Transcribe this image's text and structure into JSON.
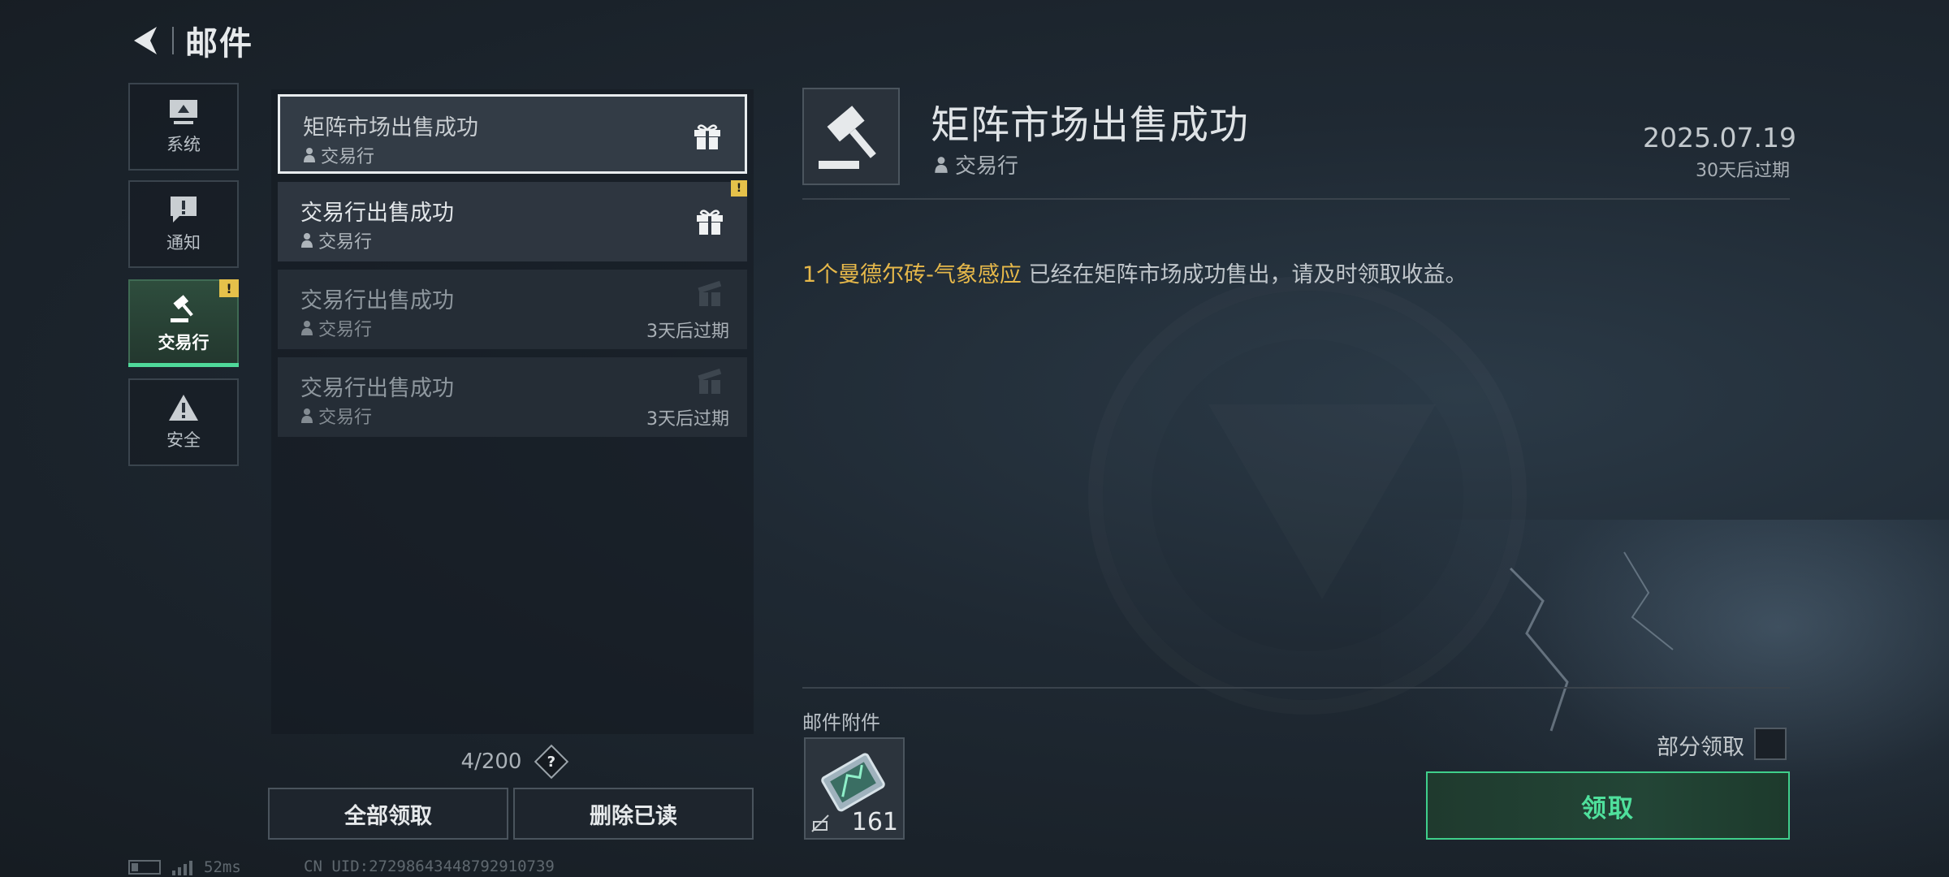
{
  "header": {
    "title": "邮件"
  },
  "categories": [
    {
      "label": "系统",
      "icon": "monitor-icon"
    },
    {
      "label": "通知",
      "icon": "alert-message-icon"
    },
    {
      "label": "交易行",
      "icon": "gavel-icon",
      "badge": "!"
    },
    {
      "label": "安全",
      "icon": "warning-triangle-icon"
    }
  ],
  "mails": [
    {
      "title": "矩阵市场出售成功",
      "sender": "交易行",
      "attachment_icon": "gift-icon"
    },
    {
      "title": "交易行出售成功",
      "sender": "交易行",
      "attachment_icon": "gift-icon",
      "badge": "!"
    },
    {
      "title": "交易行出售成功",
      "sender": "交易行",
      "attachment_icon": "gift-open-icon",
      "expire": "3天后过期"
    },
    {
      "title": "交易行出售成功",
      "sender": "交易行",
      "attachment_icon": "gift-open-icon",
      "expire": "3天后过期"
    }
  ],
  "list_footer": {
    "count": "4/200",
    "help": "?",
    "claim_all": "全部领取",
    "delete_read": "删除已读"
  },
  "detail": {
    "title": "矩阵市场出售成功",
    "sender": "交易行",
    "date": "2025.07.19",
    "expire": "30天后过期",
    "body_highlight": "1个曼德尔砖-气象感应",
    "body_rest": " 已经在矩阵市场成功售出，请及时领取收益。",
    "attachments_label": "邮件附件",
    "attachment_count": "161",
    "partial_claim_label": "部分领取",
    "claim_button": "领取"
  },
  "status_bar": {
    "ping": "52ms",
    "uid": "CN UID:27298643448792910739"
  },
  "colors": {
    "accent_green": "#4fe09c",
    "highlight_gold": "#e6b84a",
    "badge_yellow": "#e5c14a"
  }
}
